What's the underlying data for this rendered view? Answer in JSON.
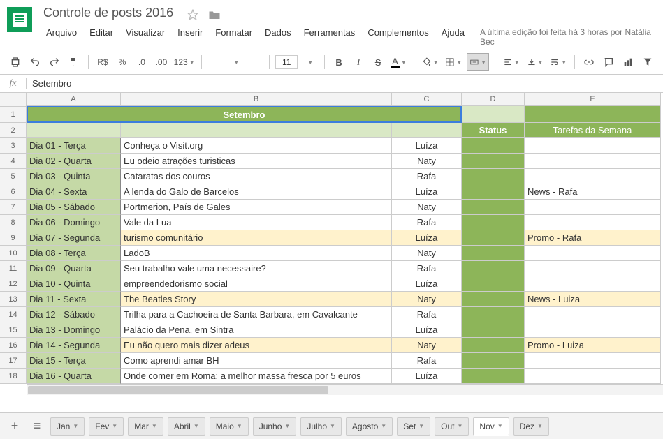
{
  "doc": {
    "title": "Controle de posts 2016"
  },
  "menu": {
    "items": [
      "Arquivo",
      "Editar",
      "Visualizar",
      "Inserir",
      "Formatar",
      "Dados",
      "Ferramentas",
      "Complementos",
      "Ajuda"
    ],
    "edit_info": "A última edição foi feita há 3 horas por Natália Bec"
  },
  "toolbar": {
    "currency": "R$",
    "percent": "%",
    "dec_dec": ".0",
    "dec_inc": ".00",
    "num_fmt": "123",
    "font": "",
    "font_size": "11",
    "bold": "B",
    "italic": "I",
    "strike": "S",
    "color_text": "A"
  },
  "formula": {
    "fx": "fx",
    "value": "Setembro"
  },
  "columns": [
    "A",
    "B",
    "C",
    "D",
    "E"
  ],
  "sheet": {
    "merged_title": "Setembro",
    "status_header": "Status",
    "tarefas_header": "Tarefas da Semana",
    "rows": [
      {
        "n": 3,
        "date": "Dia 01 - Terça",
        "b": "Conheça o Visit.org",
        "c": "Luíza",
        "e": "",
        "hl": false
      },
      {
        "n": 4,
        "date": "Dia 02 - Quarta",
        "b": "Eu odeio atrações turisticas",
        "c": "Naty",
        "e": "",
        "hl": false
      },
      {
        "n": 5,
        "date": "Dia 03 - Quinta",
        "b": "Cataratas dos couros",
        "c": "Rafa",
        "e": "",
        "hl": false
      },
      {
        "n": 6,
        "date": "Dia 04 - Sexta",
        "b": "A lenda do Galo de Barcelos",
        "c": "Luíza",
        "e": "News - Rafa",
        "hl": false
      },
      {
        "n": 7,
        "date": "Dia 05 - Sábado",
        "b": "Portmerion, País de Gales",
        "c": "Naty",
        "e": "",
        "hl": false
      },
      {
        "n": 8,
        "date": "Dia 06 - Domingo",
        "b": "Vale da Lua",
        "c": "Rafa",
        "e": "",
        "hl": false
      },
      {
        "n": 9,
        "date": "Dia 07 - Segunda",
        "b": " turismo comunitário",
        "c": "Luíza",
        "e": "Promo - Rafa",
        "hl": true
      },
      {
        "n": 10,
        "date": "Dia 08 - Terça",
        "b": "LadoB",
        "c": "Naty",
        "e": "",
        "hl": false
      },
      {
        "n": 11,
        "date": "Dia 09 - Quarta",
        "b": "Seu trabalho vale uma necessaire?",
        "c": "Rafa",
        "e": "",
        "hl": false
      },
      {
        "n": 12,
        "date": "Dia 10 - Quinta",
        "b": "empreendedorismo social",
        "c": "Luíza",
        "e": "",
        "hl": false
      },
      {
        "n": 13,
        "date": "Dia 11 - Sexta",
        "b": "The Beatles Story",
        "c": "Naty",
        "e": "News - Luiza",
        "hl": true
      },
      {
        "n": 14,
        "date": "Dia 12 - Sábado",
        "b": "Trilha para a Cachoeira de Santa Barbara, em Cavalcante",
        "c": "Rafa",
        "e": "",
        "hl": false
      },
      {
        "n": 15,
        "date": "Dia 13 - Domingo",
        "b": "Palácio da Pena, em Sintra",
        "c": "Luíza",
        "e": "",
        "hl": false
      },
      {
        "n": 16,
        "date": "Dia 14 - Segunda",
        "b": "Eu não quero mais dizer adeus",
        "c": "Naty",
        "e": "Promo - Luiza",
        "hl": true
      },
      {
        "n": 17,
        "date": "Dia 15 - Terça",
        "b": "Como aprendi amar BH",
        "c": "Rafa",
        "e": "",
        "hl": false
      },
      {
        "n": 18,
        "date": "Dia 16 - Quarta",
        "b": "Onde comer em Roma: a melhor massa fresca por 5 euros",
        "c": "Luíza",
        "e": "",
        "hl": false
      }
    ]
  },
  "tabs": {
    "items": [
      "Jan",
      "Fev",
      "Mar",
      "Abril",
      "Maio",
      "Junho",
      "Julho",
      "Agosto",
      "Set",
      "Out",
      "Nov",
      "Dez"
    ],
    "active": "Nov"
  }
}
